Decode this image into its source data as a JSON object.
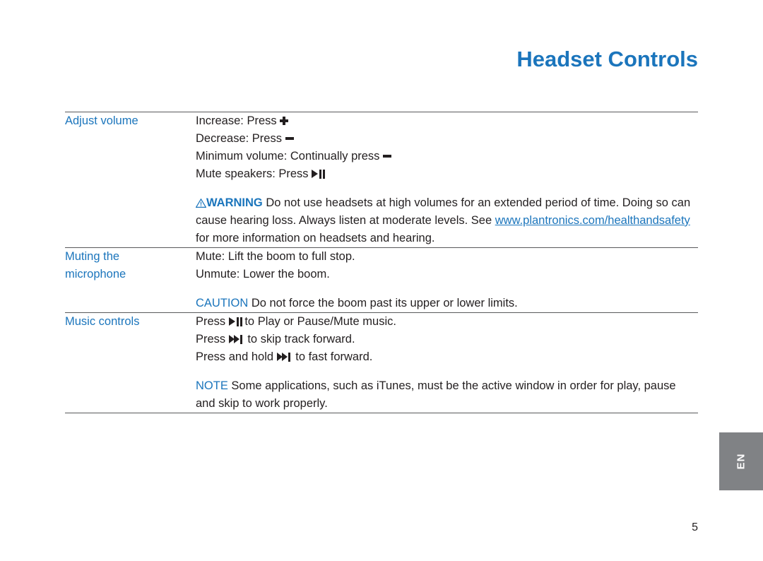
{
  "document": {
    "title": "Headset Controls",
    "page_number": "5",
    "side_tab_label": "EN",
    "accent_color": "#1b75bc",
    "rule_color": "#58595b",
    "text_color": "#231f20",
    "side_tab_color": "#808285"
  },
  "sections": [
    {
      "label_lines": [
        "Adjust volume"
      ],
      "lines": [
        {
          "pre": "Increase: Press ",
          "icon": "volume-up-plus-icon",
          "post": ""
        },
        {
          "pre": "Decrease: Press ",
          "icon": "volume-down-minus-icon",
          "post": ""
        },
        {
          "pre": "Minimum volume: Continually press ",
          "icon": "volume-down-minus-icon",
          "post": ""
        },
        {
          "pre": "Mute speakers: Press ",
          "icon": "play-pause-icon",
          "post": ""
        }
      ],
      "callout": {
        "keyword": "WARNING",
        "keyword_icon": "warning-triangle-icon",
        "text_before_link": " Do not use headsets at high volumes for an extended period of time. Doing so can cause hearing loss. Always listen at moderate levels. See ",
        "link_text": "www.plantronics.com/healthandsafety",
        "text_after_link": " for more information on headsets and hearing."
      }
    },
    {
      "label_lines": [
        "Muting the",
        "microphone"
      ],
      "lines": [
        {
          "pre": "Mute: Lift the boom to full stop.",
          "icon": "",
          "post": ""
        },
        {
          "pre": "Unmute: Lower the boom.",
          "icon": "",
          "post": ""
        }
      ],
      "callout": {
        "keyword": "CAUTION",
        "keyword_icon": "",
        "text_before_link": " Do not force the boom past its upper or lower limits.",
        "link_text": "",
        "text_after_link": ""
      }
    },
    {
      "label_lines": [
        "Music controls"
      ],
      "lines": [
        {
          "pre": "Press ",
          "icon": "play-pause-icon",
          "post": " to Play or Pause/Mute music."
        },
        {
          "pre": "Press ",
          "icon": "skip-forward-icon",
          "post": " to skip track forward."
        },
        {
          "pre": "Press and hold ",
          "icon": "skip-forward-icon",
          "post": " to fast forward."
        }
      ],
      "callout": {
        "keyword": "NOTE",
        "keyword_icon": "",
        "text_before_link": " Some applications, such as iTunes, must be the active window in order for play, pause and skip to work properly.",
        "link_text": "",
        "text_after_link": ""
      }
    }
  ]
}
